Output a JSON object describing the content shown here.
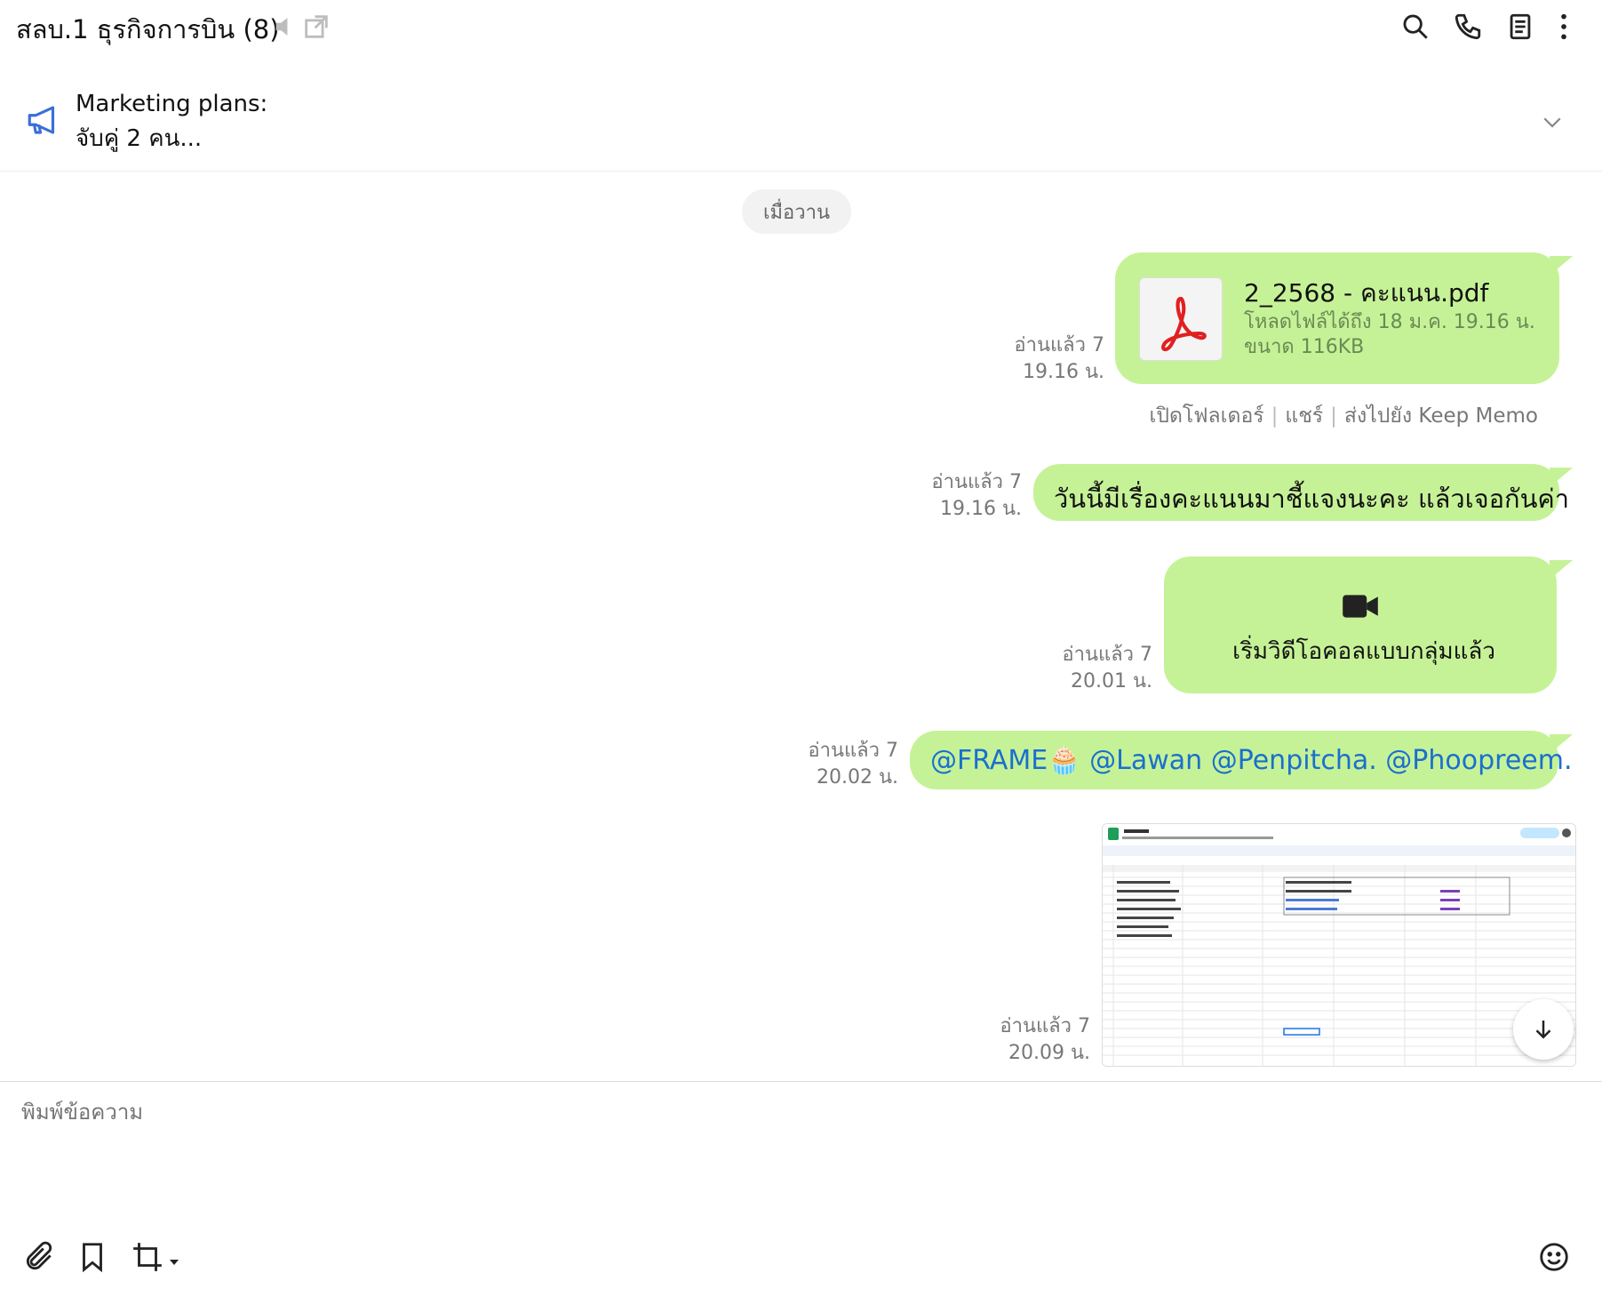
{
  "header": {
    "title": "สลบ.1 ธุรกิจการบิน (8)",
    "icons": [
      "speaker-muted-icon",
      "open-external-icon",
      "search-icon",
      "phone-icon",
      "notes-icon",
      "more-vertical-icon"
    ]
  },
  "announcement": {
    "line1": "Marketing plans:",
    "line2": "จับคู่ 2 คน..."
  },
  "chat": {
    "date_separator": "เมื่อวาน",
    "messages": [
      {
        "type": "file",
        "read": "อ่านแล้ว 7",
        "time": "19.16 น.",
        "file_name": "2_2568 - คะแนน.pdf",
        "expire": "โหลดไฟล์ได้ถึง 18 ม.ค. 19.16 น.",
        "size": "ขนาด 116KB",
        "actions": [
          "เปิดโฟลเดอร์",
          "แชร์",
          "ส่งไปยัง Keep Memo"
        ]
      },
      {
        "type": "text",
        "read": "อ่านแล้ว 7",
        "time": "19.16 น.",
        "text": "วันนี้มีเรื่องคะแนนมาชี้แจงนะคะ แล้วเจอกันค่า"
      },
      {
        "type": "call",
        "read": "อ่านแล้ว 7",
        "time": "20.01 น.",
        "text": "เริ่มวิดีโอคอลแบบกลุ่มแล้ว"
      },
      {
        "type": "mention",
        "read": "อ่านแล้ว 7",
        "time": "20.02 น.",
        "text": "@FRAME🧁 @Lawan @Penpitcha. @Phoopreem."
      },
      {
        "type": "image",
        "read": "อ่านแล้ว 7",
        "time": "20.09 น."
      }
    ]
  },
  "composer": {
    "placeholder": "พิมพ์ข้อความ"
  },
  "colors": {
    "bubble": "#c6f297",
    "mention": "#1a6fd0",
    "announce_icon": "#3b6fd8"
  }
}
